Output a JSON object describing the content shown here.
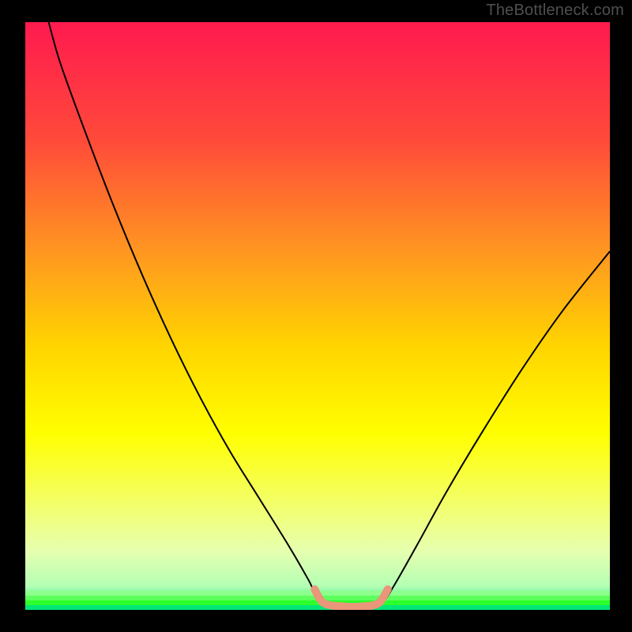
{
  "attribution": "TheBottleneck.com",
  "chart_data": {
    "type": "line",
    "title": "",
    "xlabel": "",
    "ylabel": "",
    "xlim": [
      0,
      100
    ],
    "ylim": [
      0,
      100
    ],
    "grid": false,
    "legend": false,
    "background_gradient": {
      "stops": [
        {
          "offset": 0.0,
          "color": "#ff1a4f"
        },
        {
          "offset": 0.2,
          "color": "#ff4a3a"
        },
        {
          "offset": 0.4,
          "color": "#ff9a1f"
        },
        {
          "offset": 0.55,
          "color": "#ffd400"
        },
        {
          "offset": 0.7,
          "color": "#ffff00"
        },
        {
          "offset": 0.82,
          "color": "#f3ff6a"
        },
        {
          "offset": 0.9,
          "color": "#e6ffb0"
        },
        {
          "offset": 0.96,
          "color": "#b4ffb4"
        },
        {
          "offset": 1.0,
          "color": "#00e676"
        }
      ]
    },
    "stripes": {
      "colors": [
        "#8cff8c",
        "#5cff5c",
        "#2cff2c",
        "#00e676"
      ]
    },
    "series": [
      {
        "name": "bottleneck-curve",
        "stroke": "#000000",
        "stroke_width": 2,
        "points": [
          {
            "x": 4,
            "y": 100
          },
          {
            "x": 6,
            "y": 93
          },
          {
            "x": 10,
            "y": 82
          },
          {
            "x": 15,
            "y": 69
          },
          {
            "x": 20,
            "y": 57
          },
          {
            "x": 25,
            "y": 46
          },
          {
            "x": 30,
            "y": 36
          },
          {
            "x": 35,
            "y": 27
          },
          {
            "x": 40,
            "y": 19
          },
          {
            "x": 45,
            "y": 11
          },
          {
            "x": 48.5,
            "y": 5
          },
          {
            "x": 50.5,
            "y": 1.2
          },
          {
            "x": 54,
            "y": 0.5
          },
          {
            "x": 58,
            "y": 0.5
          },
          {
            "x": 61,
            "y": 1.2
          },
          {
            "x": 63,
            "y": 4
          },
          {
            "x": 67,
            "y": 11
          },
          {
            "x": 72,
            "y": 20
          },
          {
            "x": 78,
            "y": 30
          },
          {
            "x": 85,
            "y": 41
          },
          {
            "x": 92,
            "y": 51
          },
          {
            "x": 100,
            "y": 61
          }
        ]
      },
      {
        "name": "valley-marker",
        "stroke": "#e9967a",
        "stroke_width": 10,
        "linecap": "round",
        "points": [
          {
            "x": 49.5,
            "y": 3.5
          },
          {
            "x": 51,
            "y": 1.2
          },
          {
            "x": 54,
            "y": 0.6
          },
          {
            "x": 58,
            "y": 0.6
          },
          {
            "x": 60.5,
            "y": 1.2
          },
          {
            "x": 62,
            "y": 3.5
          }
        ]
      }
    ]
  }
}
